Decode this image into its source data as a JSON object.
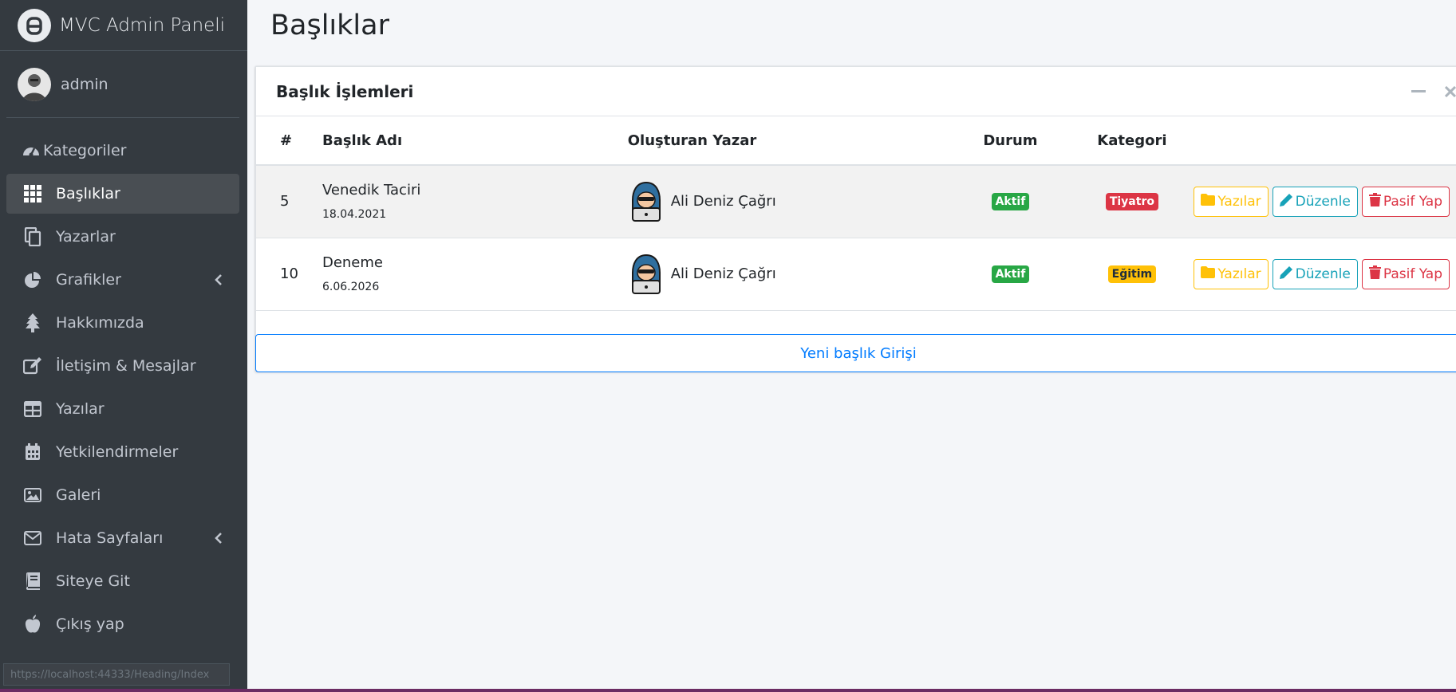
{
  "brand": {
    "title": "MVC Admin Paneli"
  },
  "user": {
    "name": "admin"
  },
  "sidebar": {
    "items": [
      {
        "label": "Kategoriler",
        "icon": "tachometer-icon",
        "active": false
      },
      {
        "label": "Başlıklar",
        "icon": "th-grid-icon",
        "active": true
      },
      {
        "label": "Yazarlar",
        "icon": "copy-icon",
        "active": false
      },
      {
        "label": "Grafikler",
        "icon": "pie-chart-icon",
        "active": false,
        "has_submenu": true
      },
      {
        "label": "Hakkımızda",
        "icon": "tree-icon",
        "active": false
      },
      {
        "label": "İletişim & Mesajlar",
        "icon": "edit-icon",
        "active": false
      },
      {
        "label": "Yazılar",
        "icon": "table-icon",
        "active": false
      },
      {
        "label": "Yetkilendirmeler",
        "icon": "calendar-icon",
        "active": false
      },
      {
        "label": "Galeri",
        "icon": "image-icon",
        "active": false
      },
      {
        "label": "Hata Sayfaları",
        "icon": "envelope-icon",
        "active": false,
        "has_submenu": true
      },
      {
        "label": "Siteye Git",
        "icon": "book-icon",
        "active": false
      },
      {
        "label": "Çıkış yap",
        "icon": "apple-icon",
        "active": false
      }
    ]
  },
  "status_bar": {
    "url": "https://localhost:44333/Heading/Index"
  },
  "page": {
    "title": "Başlıklar"
  },
  "card": {
    "title": "Başlık İşlemleri",
    "columns": [
      "#",
      "Başlık Adı",
      "Oluşturan Yazar",
      "Durum",
      "Kategori"
    ],
    "rows": [
      {
        "id": "5",
        "title": "Venedik Taciri",
        "date": "18.04.2021",
        "author": "Ali Deniz Çağrı",
        "status": "Aktif",
        "category": "Tiyatro",
        "category_color": "#dc3545"
      },
      {
        "id": "10",
        "title": "Deneme",
        "date": "6.06.2026",
        "author": "Ali Deniz Çağrı",
        "status": "Aktif",
        "category": "Eğitim",
        "category_color": "#ffc107"
      }
    ],
    "actions": {
      "posts": "Yazılar",
      "edit": "Düzenle",
      "deactivate": "Pasif Yap"
    },
    "new_button": "Yeni başlık Girişi"
  },
  "colors": {
    "sidebar_bg": "#343a40",
    "active_item": "#494e53",
    "primary": "#007bff",
    "success": "#28a745",
    "danger": "#dc3545",
    "warning": "#ffc107",
    "info": "#17a2b8"
  }
}
